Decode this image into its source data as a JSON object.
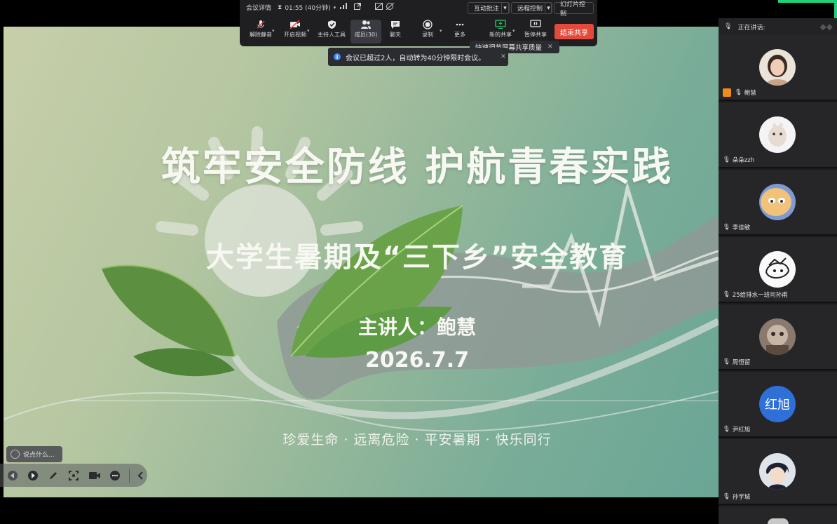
{
  "toolbar": {
    "meeting_details": "会议详情",
    "timer": "01:55 (40分钟)",
    "interactive_annotation": "互动批注",
    "remote_control": "远程控制",
    "slide_control": "幻灯片控制",
    "buttons": {
      "unmute": "解除静音",
      "start_video": "开启视频",
      "host_tools": "主持人工具",
      "members": "成员(30)",
      "chat": "聊天",
      "record": "录制",
      "more": "更多",
      "new_share": "新的共享",
      "pause_share": "暂停共享"
    },
    "end_share": "结束共享"
  },
  "tooltip": "快速调节屏幕共享质量",
  "notice": "会议已超过2人，自动转为40分钟限时会议。",
  "slide": {
    "title": "筑牢安全防线 护航青春实践",
    "subtitle": "大学生暑期及“三下乡”安全教育",
    "speaker": "主讲人：鲍慧",
    "date": "2026.7.7",
    "motto": "珍爱生命 · 远离危险 · 平安暑期 · 快乐同行"
  },
  "comment_placeholder": "说点什么...",
  "sidebar": {
    "speaking_label": "正在讲话:",
    "participants": [
      {
        "name": "鲍慧",
        "host": true
      },
      {
        "name": "朵朵zzh"
      },
      {
        "name": "李佳敏"
      },
      {
        "name": "25给排水一班司孙甫"
      },
      {
        "name": "周恒留"
      },
      {
        "name": "尹红旭",
        "avatar_text": "红旭"
      },
      {
        "name": "孙宇城"
      }
    ]
  },
  "colors": {
    "accent_green": "#1fd07a",
    "end_share_red": "#e34a3c",
    "avatar_blue": "#2e6fd8"
  }
}
